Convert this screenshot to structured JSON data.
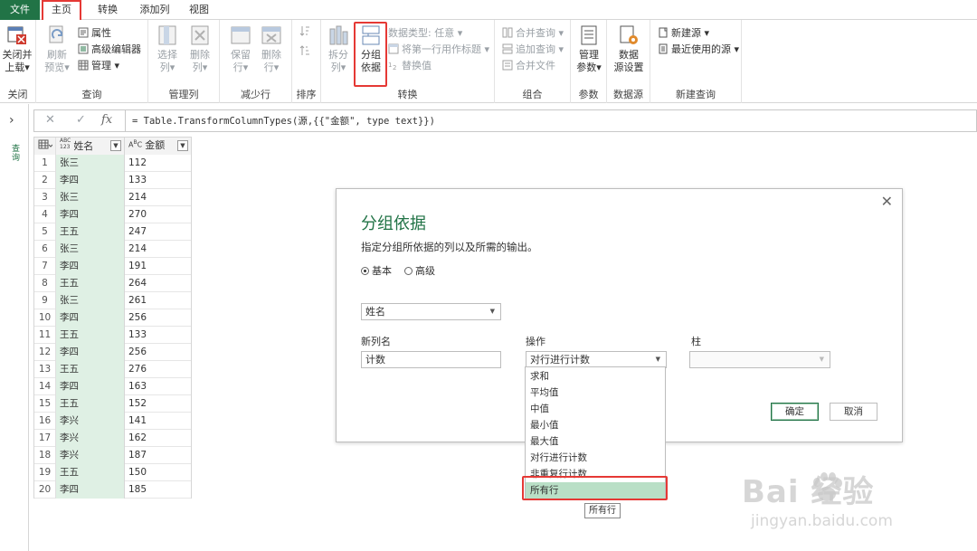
{
  "ribbon": {
    "tabs": [
      {
        "label": "文件"
      },
      {
        "label": "主页"
      },
      {
        "label": "转换"
      },
      {
        "label": "添加列"
      },
      {
        "label": "视图"
      }
    ],
    "groups": {
      "close": {
        "label": "关闭",
        "close_load": "关闭并",
        "close_load2": "上载",
        "caret": "▾"
      },
      "query": {
        "label": "查询",
        "refresh": "刷新",
        "refresh2": "预览",
        "properties": "属性",
        "advanced_editor": "高级编辑器",
        "manage": "管理"
      },
      "manage_columns": {
        "label": "管理列",
        "choose": "选择",
        "choose2": "列",
        "remove": "删除",
        "remove2": "列"
      },
      "reduce_rows": {
        "label": "减少行",
        "keep": "保留",
        "keep2": "行",
        "remove": "删除",
        "remove2": "行"
      },
      "sort": {
        "label": "排序"
      },
      "transform": {
        "label": "转换",
        "split": "拆分",
        "split2": "列",
        "group_by": "分组",
        "group_by2": "依据",
        "data_type": "数据类型: 任意",
        "first_row": "将第一行用作标题",
        "replace": "替换值"
      },
      "combine": {
        "label": "组合",
        "merge": "合并查询",
        "append": "追加查询",
        "merge_files": "合并文件"
      },
      "parameters": {
        "label": "参数",
        "manage": "管理",
        "manage2": "参数"
      },
      "data_source": {
        "label": "数据源",
        "settings": "数据",
        "settings2": "源设置"
      },
      "new_query": {
        "label": "新建查询",
        "new_source": "新建源",
        "recent": "最近使用的源"
      }
    }
  },
  "leftnav": {
    "chevron": "›",
    "label": "查询"
  },
  "formula_bar": {
    "cancel": "✕",
    "commit": "✓",
    "fx": "fx",
    "text": "= Table.TransformColumnTypes(源,{{\"金额\", type text}})"
  },
  "grid": {
    "columns": [
      {
        "type_icon": "ABC 123",
        "name": "姓名"
      },
      {
        "type_icon": "ABC",
        "name": "金额"
      }
    ],
    "rows": [
      {
        "idx": "1",
        "name": "张三",
        "amount": "112"
      },
      {
        "idx": "2",
        "name": "李四",
        "amount": "133"
      },
      {
        "idx": "3",
        "name": "张三",
        "amount": "214"
      },
      {
        "idx": "4",
        "name": "李四",
        "amount": "270"
      },
      {
        "idx": "5",
        "name": "王五",
        "amount": "247"
      },
      {
        "idx": "6",
        "name": "张三",
        "amount": "214"
      },
      {
        "idx": "7",
        "name": "李四",
        "amount": "191"
      },
      {
        "idx": "8",
        "name": "王五",
        "amount": "264"
      },
      {
        "idx": "9",
        "name": "张三",
        "amount": "261"
      },
      {
        "idx": "10",
        "name": "李四",
        "amount": "256"
      },
      {
        "idx": "11",
        "name": "王五",
        "amount": "133"
      },
      {
        "idx": "12",
        "name": "李四",
        "amount": "256"
      },
      {
        "idx": "13",
        "name": "王五",
        "amount": "276"
      },
      {
        "idx": "14",
        "name": "李四",
        "amount": "163"
      },
      {
        "idx": "15",
        "name": "王五",
        "amount": "152"
      },
      {
        "idx": "16",
        "name": "李兴",
        "amount": "141"
      },
      {
        "idx": "17",
        "name": "李兴",
        "amount": "162"
      },
      {
        "idx": "18",
        "name": "李兴",
        "amount": "187"
      },
      {
        "idx": "19",
        "name": "王五",
        "amount": "150"
      },
      {
        "idx": "20",
        "name": "李四",
        "amount": "185"
      }
    ]
  },
  "dialog": {
    "close": "✕",
    "title": "分组依据",
    "description": "指定分组所依据的列以及所需的输出。",
    "radio_basic": "基本",
    "radio_advanced": "高级",
    "group_column": "姓名",
    "new_column_label": "新列名",
    "new_column_value": "计数",
    "operation_label": "操作",
    "operation_value": "对行进行计数",
    "column_label": "柱",
    "column_value": "",
    "ok": "确定",
    "cancel": "取消"
  },
  "dropdown": {
    "items": [
      {
        "label": "求和"
      },
      {
        "label": "平均值"
      },
      {
        "label": "中值"
      },
      {
        "label": "最小值"
      },
      {
        "label": "最大值"
      },
      {
        "label": "对行进行计数"
      },
      {
        "label": "非重复行计数"
      },
      {
        "label": "所有行"
      }
    ],
    "selected": "所有行",
    "tooltip": "所有行"
  },
  "watermark": {
    "brand": "Bai 经验",
    "url": "jingyan.baidu.com"
  },
  "colors": {
    "accent": "#217346",
    "highlight": "#e53935",
    "selected_row": "#b9dfc6",
    "name_column": "#dff0e4"
  }
}
